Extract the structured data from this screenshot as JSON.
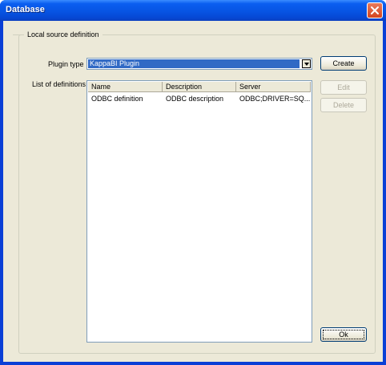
{
  "window": {
    "title": "Database"
  },
  "group": {
    "title": "Local source definition"
  },
  "plugin_type": {
    "label": "Plugin type",
    "value": "KappaBI Plugin"
  },
  "definitions": {
    "label": "List of definitions",
    "columns": [
      "Name",
      "Description",
      "Server"
    ],
    "rows": [
      [
        "ODBC definition",
        "ODBC description",
        "ODBC;DRIVER=SQ..."
      ]
    ]
  },
  "buttons": {
    "create": "Create",
    "edit": "Edit",
    "delete": "Delete",
    "ok": "Ok"
  }
}
